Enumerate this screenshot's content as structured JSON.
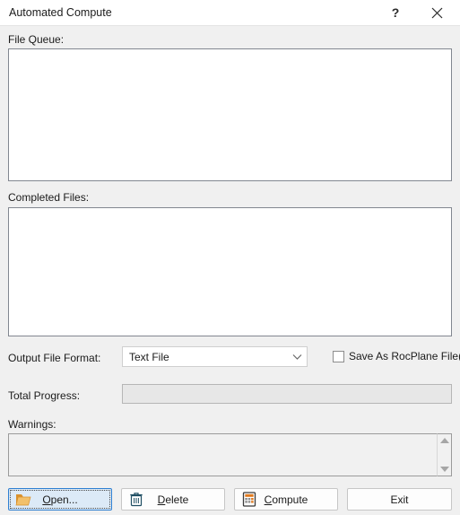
{
  "window": {
    "title": "Automated Compute",
    "help_button": "?",
    "close_button": "×",
    "background_color": "#f0f0f0",
    "titlebar_color": "#ffffff"
  },
  "file_queue": {
    "label": "File Queue:",
    "items": []
  },
  "completed_files": {
    "label": "Completed Files:",
    "items": []
  },
  "output_format": {
    "label": "Output File Format:",
    "selected": "Text File",
    "options": [
      "Text File"
    ],
    "arrow_icon": "chevron-down-icon"
  },
  "save_as_rocplane": {
    "label": "Save As RocPlane File(s)",
    "checked": false
  },
  "total_progress": {
    "label": "Total Progress:",
    "value": 0,
    "value_text": ""
  },
  "warnings": {
    "label": "Warnings:",
    "text": "",
    "scroll_up_icon": "triangle-up-icon",
    "scroll_down_icon": "triangle-down-icon"
  },
  "buttons": [
    {
      "name": "open",
      "label_before": "",
      "mnemonic": "O",
      "label_after": "pen...",
      "icon": "folder-icon",
      "focused": true
    },
    {
      "name": "delete",
      "label_before": "",
      "mnemonic": "D",
      "label_after": "elete",
      "icon": "trash-icon",
      "focused": false
    },
    {
      "name": "compute",
      "label_before": "",
      "mnemonic": "C",
      "label_after": "ompute",
      "icon": "calculator-icon",
      "focused": false
    },
    {
      "name": "exit",
      "label_before": "Exit",
      "mnemonic": "",
      "label_after": "",
      "icon": "",
      "focused": false
    }
  ],
  "colors": {
    "focus_border": "#2f7fd1",
    "focus_fill": "#dceaf7",
    "folder_icon": "#e8a33d",
    "trash_icon": "#1f4e63",
    "listbox_border": "#828790"
  }
}
